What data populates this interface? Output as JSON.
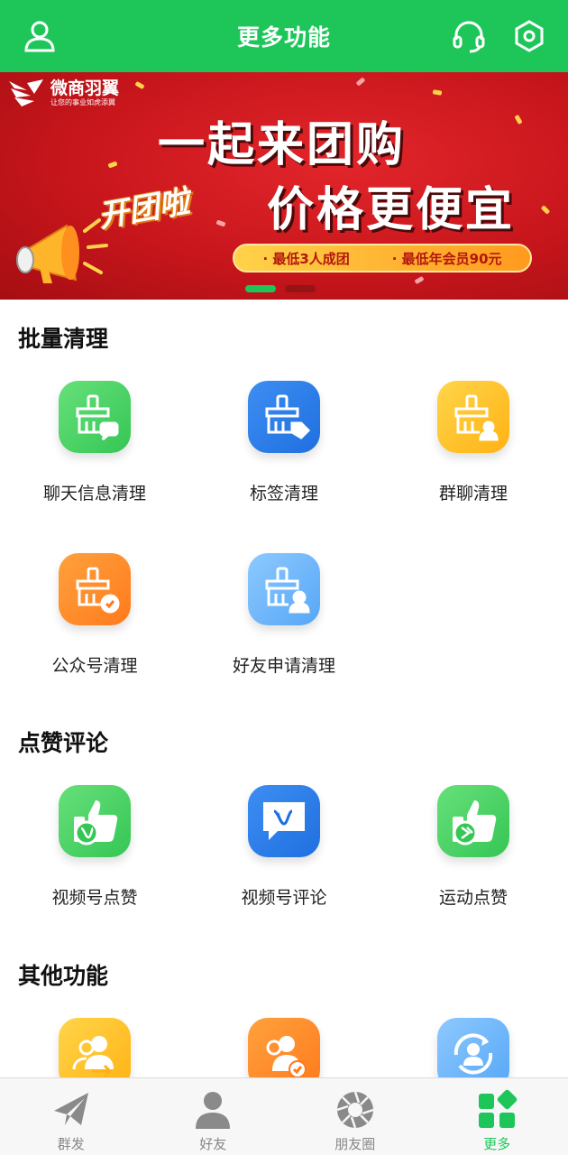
{
  "header": {
    "title": "更多功能",
    "icons": [
      "user-icon",
      "headset-icon",
      "settings-icon"
    ]
  },
  "banner": {
    "logo_name": "微商羽翼",
    "logo_slogan": "让您的事业如虎添翼",
    "headline1": "一起来团购",
    "headline2": "价格更便宜",
    "tag": "开团啦",
    "pill_items": [
      "· 最低3人成团",
      "· 最低年会员90元"
    ],
    "active_slide": 0
  },
  "sections": [
    {
      "title": "批量清理",
      "items": [
        {
          "label": "聊天信息清理",
          "icon": "broom-chat-icon",
          "color": "green"
        },
        {
          "label": "标签清理",
          "icon": "broom-tag-icon",
          "color": "blue"
        },
        {
          "label": "群聊清理",
          "icon": "broom-group-icon",
          "color": "yellow"
        },
        {
          "label": "公众号清理",
          "icon": "broom-official-account-icon",
          "color": "orange"
        },
        {
          "label": "好友申请清理",
          "icon": "broom-friend-request-icon",
          "color": "lightblue"
        }
      ]
    },
    {
      "title": "点赞评论",
      "items": [
        {
          "label": "视频号点赞",
          "icon": "thumbs-up-video-icon",
          "color": "green"
        },
        {
          "label": "视频号评论",
          "icon": "comment-video-icon",
          "color": "blue"
        },
        {
          "label": "运动点赞",
          "icon": "thumbs-up-sport-icon",
          "color": "green"
        }
      ]
    },
    {
      "title": "其他功能",
      "items": [
        {
          "label": "",
          "icon": "users-transfer-icon",
          "color": "yellow"
        },
        {
          "label": "",
          "icon": "users-check-icon",
          "color": "orange"
        },
        {
          "label": "",
          "icon": "user-refresh-icon",
          "color": "lightblue"
        }
      ]
    }
  ],
  "bottom_nav": [
    {
      "label": "群发",
      "icon": "paper-plane-icon",
      "active": false
    },
    {
      "label": "好友",
      "icon": "person-icon",
      "active": false
    },
    {
      "label": "朋友圈",
      "icon": "aperture-icon",
      "active": false
    },
    {
      "label": "更多",
      "icon": "grid-icon",
      "active": true
    }
  ],
  "colors": {
    "primary": "#1ec65a",
    "banner_red": "#c8161c",
    "nav_inactive": "#888888"
  }
}
